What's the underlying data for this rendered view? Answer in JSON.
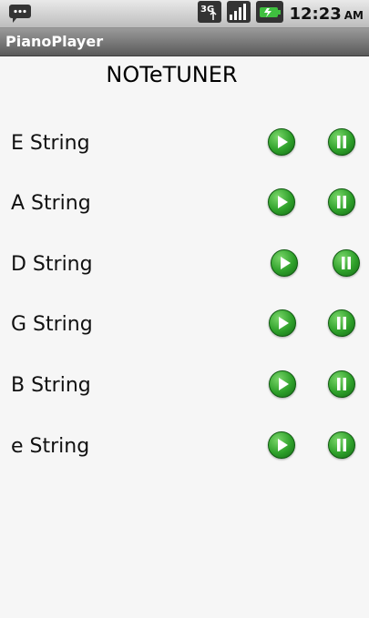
{
  "app": {
    "title": "PianoPlayer",
    "heading": "NOTeTUNER"
  },
  "status": {
    "time": "12:23",
    "ampm": "AM",
    "network": "3G"
  },
  "strings": [
    {
      "label": "E String"
    },
    {
      "label": "A String"
    },
    {
      "label": "D String"
    },
    {
      "label": "G String"
    },
    {
      "label": "B String"
    },
    {
      "label": "e String"
    }
  ],
  "icons": {
    "play": "play-icon",
    "pause": "pause-icon"
  },
  "colors": {
    "button_green": "#2ea02a"
  }
}
